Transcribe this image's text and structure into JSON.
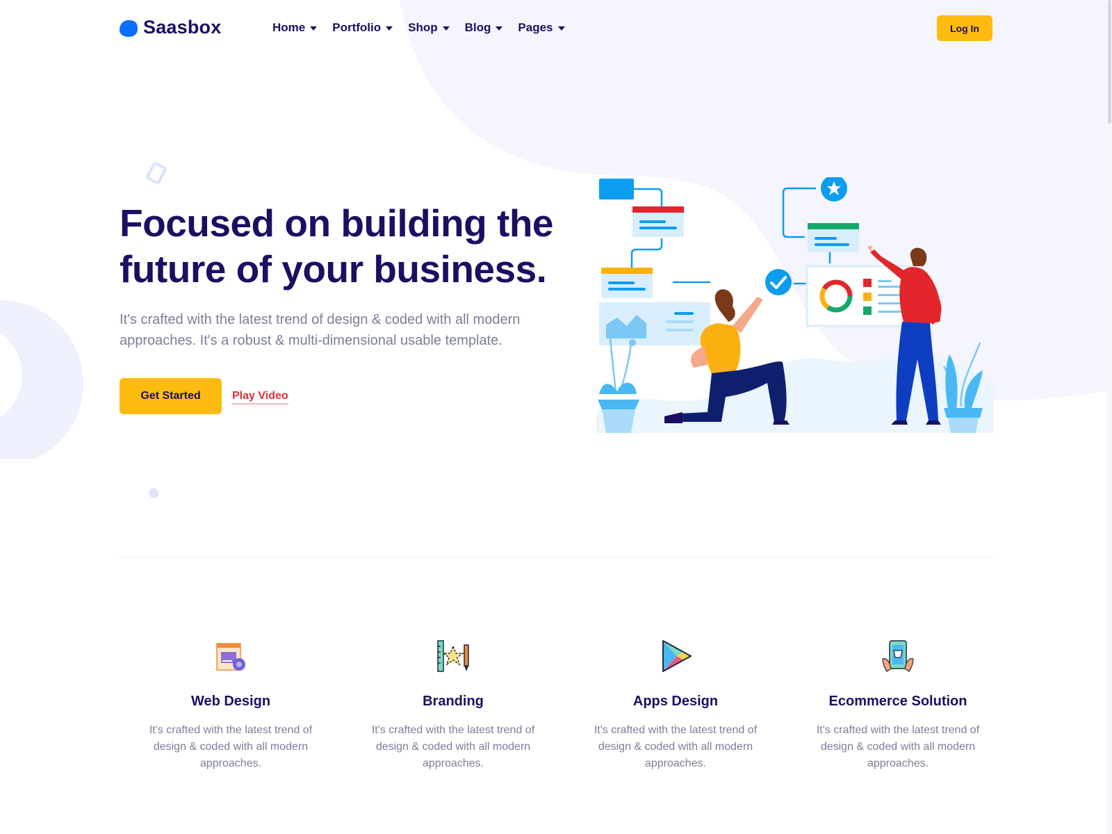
{
  "brand": {
    "name": "Saasbox",
    "accent": "#0d6efd"
  },
  "nav": {
    "items": [
      {
        "label": "Home"
      },
      {
        "label": "Portfolio"
      },
      {
        "label": "Shop"
      },
      {
        "label": "Blog"
      },
      {
        "label": "Pages"
      }
    ],
    "login_label": "Log In"
  },
  "hero": {
    "title": "Focused on building the future of your business.",
    "subtitle": "It's crafted with the latest trend of design & coded with all modern approaches. It's a robust & multi-dimensional usable template.",
    "cta_label": "Get Started",
    "video_label": "Play Video"
  },
  "services": [
    {
      "title": "Web Design",
      "text": "It's crafted with the latest trend of design & coded with all modern approaches.",
      "icon": "web-design-icon"
    },
    {
      "title": "Branding",
      "text": "It's crafted with the latest trend of design & coded with all modern approaches.",
      "icon": "branding-icon"
    },
    {
      "title": "Apps Design",
      "text": "It's crafted with the latest trend of design & coded with all modern approaches.",
      "icon": "apps-design-icon"
    },
    {
      "title": "Ecommerce Solution",
      "text": "It's crafted with the latest trend of design & coded with all modern approaches.",
      "icon": "ecommerce-icon"
    }
  ],
  "colors": {
    "primary_text": "#1d0e62",
    "muted_text": "#7b7e98",
    "button_yellow": "#fdbb10",
    "link_red": "#e0303a",
    "blob_bg": "#f4f5fd"
  }
}
